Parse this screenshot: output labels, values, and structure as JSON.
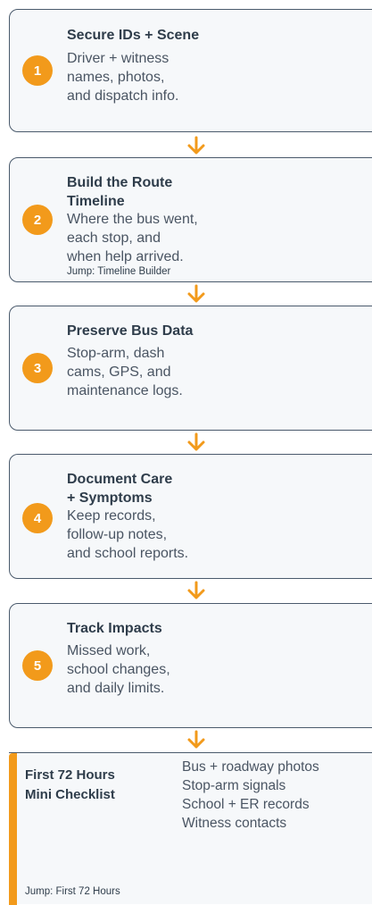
{
  "steps": [
    {
      "number": "1",
      "title": "Secure IDs + Scene",
      "desc": "Driver + witness\nnames, photos,\nand dispatch info."
    },
    {
      "number": "2",
      "title": "Build the Route\nTimeline",
      "desc": "Where the bus went,\neach stop, and\nwhen help arrived.",
      "link": "Jump: Timeline Builder"
    },
    {
      "number": "3",
      "title": "Preserve Bus Data",
      "desc": "Stop-arm, dash\ncams, GPS, and\nmaintenance logs."
    },
    {
      "number": "4",
      "title": "Document Care\n+ Symptoms",
      "desc": "Keep records,\nfollow-up notes,\nand school reports."
    },
    {
      "number": "5",
      "title": "Track Impacts",
      "desc": "Missed work,\nschool changes,\nand daily limits."
    }
  ],
  "checklist": {
    "title": "First 72 Hours\nMini Checklist",
    "items": [
      "Bus + roadway photos",
      "Stop-arm signals",
      "School + ER records",
      "Witness contacts"
    ],
    "link": "Jump: First 72 Hours"
  },
  "colors": {
    "accent": "#f29a1b",
    "border": "#4a5a6c",
    "card_bg": "#f6f8fa"
  },
  "icons": {
    "connector": "arrow-down-icon"
  }
}
